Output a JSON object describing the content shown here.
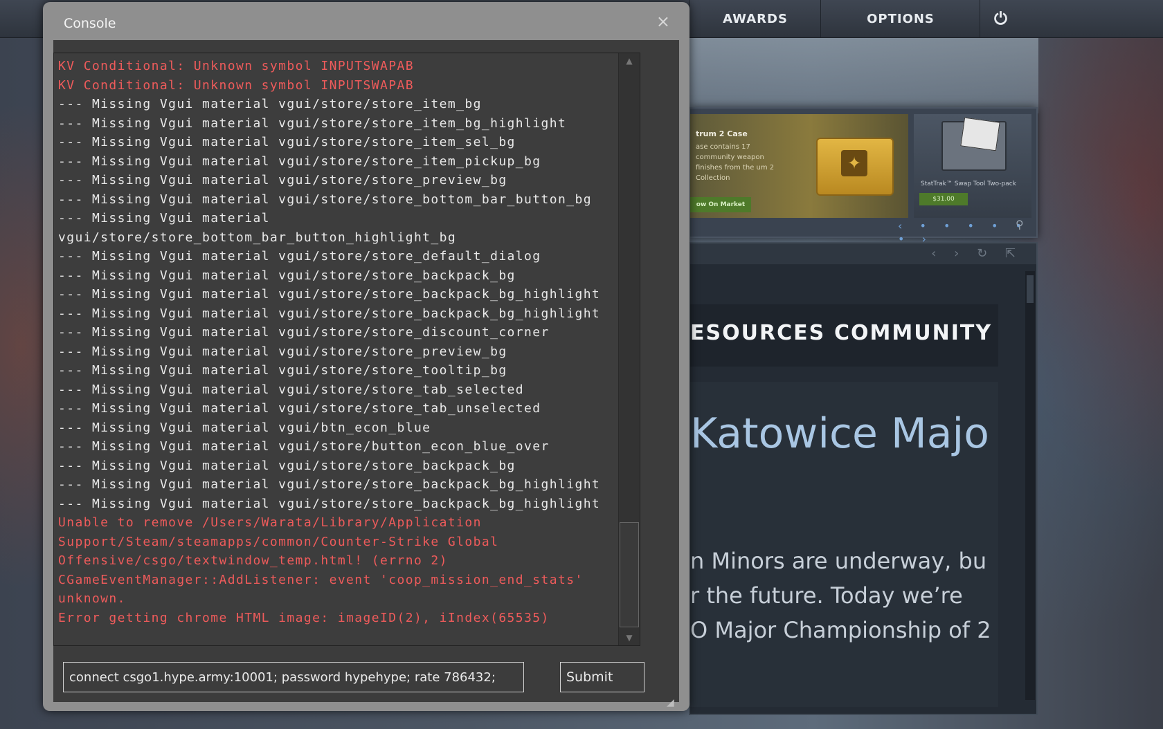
{
  "background": {
    "nav": {
      "awards": "AWARDS",
      "options": "OPTIONS",
      "power_icon": "⏻"
    },
    "store": {
      "case_title": "trum 2 Case",
      "case_desc": "ase contains 17 community weapon finishes from the um 2 Collection",
      "market_button": "ow On Market",
      "tool_caption": "StatTrak™ Swap Tool Two-pack",
      "tool_price": "$31.00",
      "pager": "‹ • • • • • • ›",
      "search_icon": "⚲"
    },
    "news": {
      "toolbar_icons": "‹ › ↻ ⇱",
      "nav_resources": "ESOURCES",
      "nav_community": "COMMUNITY",
      "headline": "Katowice Majo",
      "line1": "n Minors are underway, bu",
      "line2": "r the future. Today we’re",
      "line3": "O Major Championship of 2"
    }
  },
  "console": {
    "title": "Console",
    "close_icon": "×",
    "log": [
      {
        "type": "warn",
        "text": "KV Conditional: Unknown symbol INPUTSWAPAB"
      },
      {
        "type": "warn",
        "text": "KV Conditional: Unknown symbol INPUTSWAPAB"
      },
      {
        "type": "info",
        "text": "--- Missing Vgui material vgui/store/store_item_bg"
      },
      {
        "type": "info",
        "text": "--- Missing Vgui material vgui/store/store_item_bg_highlight"
      },
      {
        "type": "info",
        "text": "--- Missing Vgui material vgui/store/store_item_sel_bg"
      },
      {
        "type": "info",
        "text": "--- Missing Vgui material vgui/store/store_item_pickup_bg"
      },
      {
        "type": "info",
        "text": "--- Missing Vgui material vgui/store/store_preview_bg"
      },
      {
        "type": "info",
        "text": "--- Missing Vgui material vgui/store/store_bottom_bar_button_bg"
      },
      {
        "type": "info",
        "text": "--- Missing Vgui material"
      },
      {
        "type": "info",
        "text": "vgui/store/store_bottom_bar_button_highlight_bg"
      },
      {
        "type": "info",
        "text": "--- Missing Vgui material vgui/store/store_default_dialog"
      },
      {
        "type": "info",
        "text": "--- Missing Vgui material vgui/store/store_backpack_bg"
      },
      {
        "type": "info",
        "text": "--- Missing Vgui material vgui/store/store_backpack_bg_highlight"
      },
      {
        "type": "info",
        "text": "--- Missing Vgui material vgui/store/store_backpack_bg_highlight"
      },
      {
        "type": "info",
        "text": "--- Missing Vgui material vgui/store/store_discount_corner"
      },
      {
        "type": "info",
        "text": "--- Missing Vgui material vgui/store/store_preview_bg"
      },
      {
        "type": "info",
        "text": "--- Missing Vgui material vgui/store/store_tooltip_bg"
      },
      {
        "type": "info",
        "text": "--- Missing Vgui material vgui/store/store_tab_selected"
      },
      {
        "type": "info",
        "text": "--- Missing Vgui material vgui/store/store_tab_unselected"
      },
      {
        "type": "info",
        "text": "--- Missing Vgui material vgui/btn_econ_blue"
      },
      {
        "type": "info",
        "text": "--- Missing Vgui material vgui/store/button_econ_blue_over"
      },
      {
        "type": "info",
        "text": "--- Missing Vgui material vgui/store/store_backpack_bg"
      },
      {
        "type": "info",
        "text": "--- Missing Vgui material vgui/store/store_backpack_bg_highlight"
      },
      {
        "type": "info",
        "text": "--- Missing Vgui material vgui/store/store_backpack_bg_highlight"
      },
      {
        "type": "warn",
        "text": "Unable to remove /Users/Warata/Library/Application"
      },
      {
        "type": "warn",
        "text": "Support/Steam/steamapps/common/Counter-Strike Global"
      },
      {
        "type": "warn",
        "text": "Offensive/csgo/textwindow_temp.html! (errno 2)"
      },
      {
        "type": "warn",
        "text": "CGameEventManager::AddListener: event 'coop_mission_end_stats'"
      },
      {
        "type": "warn",
        "text": "unknown."
      },
      {
        "type": "warn",
        "text": "Error getting chrome HTML image: imageID(2), iIndex(65535)"
      }
    ],
    "input_value": "connect csgo1.hype.army:10001; password hypehype; rate 786432;",
    "submit_label": "Submit",
    "scroll_up_icon": "▲",
    "scroll_down_icon": "▼",
    "resize_icon": "◢"
  },
  "colors": {
    "warn_text": "#ee5b5b",
    "info_text": "#e8e8e8",
    "console_frame": "#8f8f8f",
    "console_pane": "#3c3c3c"
  }
}
